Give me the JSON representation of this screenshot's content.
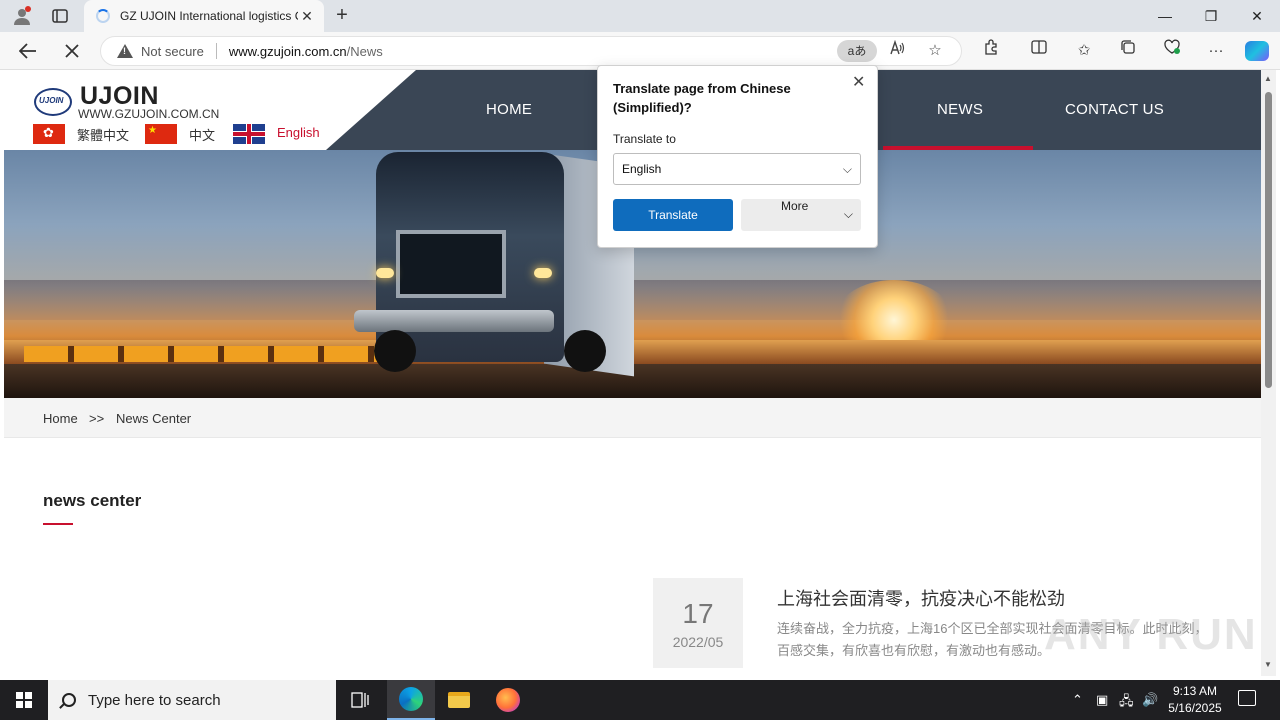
{
  "browser": {
    "tab_title": "GZ UJOIN International logistics C",
    "new_tab": "+",
    "close_tab": "✕",
    "security_label": "Not secure",
    "url_host": "www.gzujoin.com.cn",
    "url_path": "/News",
    "translate_icon": "aあ",
    "window_min": "—",
    "window_restore": "❐",
    "window_close": "✕"
  },
  "site": {
    "brand": "UJOIN",
    "brand_mark": "UJOIN",
    "brand_url": "WWW.GZUJOIN.COM.CN",
    "languages": [
      {
        "label": "繁體中文",
        "flag": "hk-flag"
      },
      {
        "label": "中文",
        "flag": "cn-flag"
      },
      {
        "label": "English",
        "flag": "uk-flag"
      }
    ],
    "nav": [
      {
        "label": "HOME"
      },
      {
        "label": "NEWS",
        "active": true
      },
      {
        "label": "CONTACT US"
      }
    ],
    "active_color": "#c8102e",
    "nav_bg": "#3a4655"
  },
  "breadcrumb": {
    "home": "Home",
    "sep": ">>",
    "current": "News Center"
  },
  "news_section": {
    "title": "news center",
    "items": [
      {
        "day": "17",
        "year_month": "2022/05",
        "title": "上海社会面清零，抗疫决心不能松劲",
        "excerpt": "连续奋战，全力抗疫，上海16个区已全部实现社会面清零目标。此时此刻，百感交集，有欣喜也有欣慰，有激动也有感动。"
      }
    ]
  },
  "translate_popup": {
    "title": "Translate page from Chinese (Simplified)?",
    "label": "Translate to",
    "selected_language": "English",
    "translate_button": "Translate",
    "more_button": "More"
  },
  "watermark": "ANY RUN",
  "taskbar": {
    "search_placeholder": "Type here to search",
    "time": "9:13 AM",
    "date": "5/16/2025"
  }
}
